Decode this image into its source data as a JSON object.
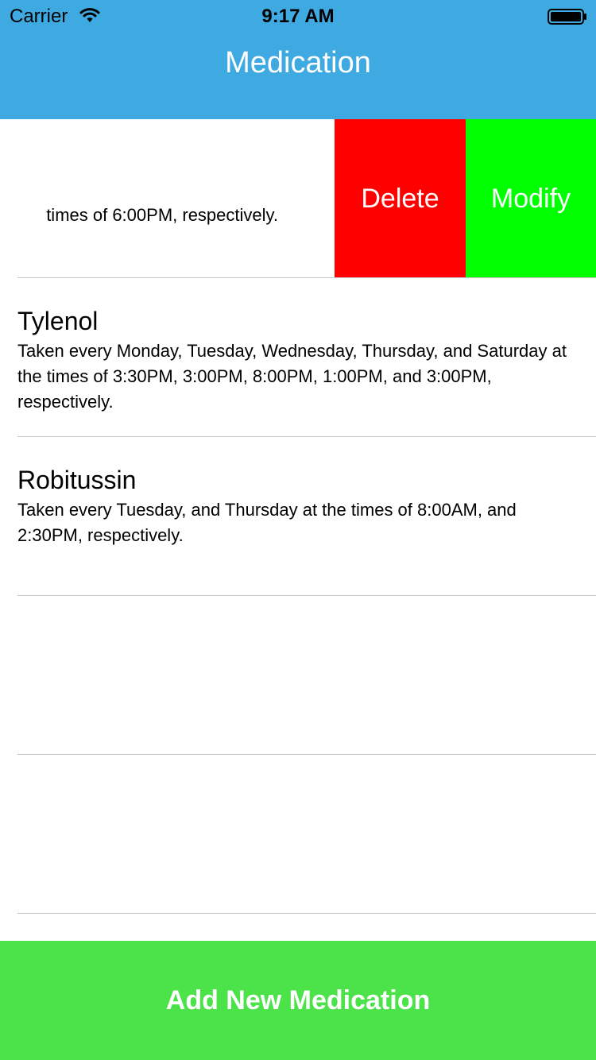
{
  "status_bar": {
    "carrier": "Carrier",
    "time": "9:17 AM",
    "icons": [
      "wifi-icon",
      "battery-icon"
    ]
  },
  "nav": {
    "title": "Medication"
  },
  "colors": {
    "header": "#3fa9e1",
    "delete": "#ff0000",
    "modify": "#00ff00",
    "add_button": "#4ce24a"
  },
  "list": {
    "swiped_row": {
      "visible_text": "times of 6:00PM, respectively.",
      "delete_label": "Delete",
      "modify_label": "Modify"
    },
    "items": [
      {
        "name": "Tylenol",
        "description": "Taken every Monday, Tuesday, Wednesday, Thursday, and Saturday at the times of 3:30PM, 3:00PM, 8:00PM, 1:00PM, and 3:00PM, respectively."
      },
      {
        "name": "Robitussin",
        "description": "Taken every Tuesday, and Thursday at the times of 8:00AM, and 2:30PM, respectively."
      }
    ]
  },
  "footer": {
    "add_label": "Add New Medication"
  }
}
